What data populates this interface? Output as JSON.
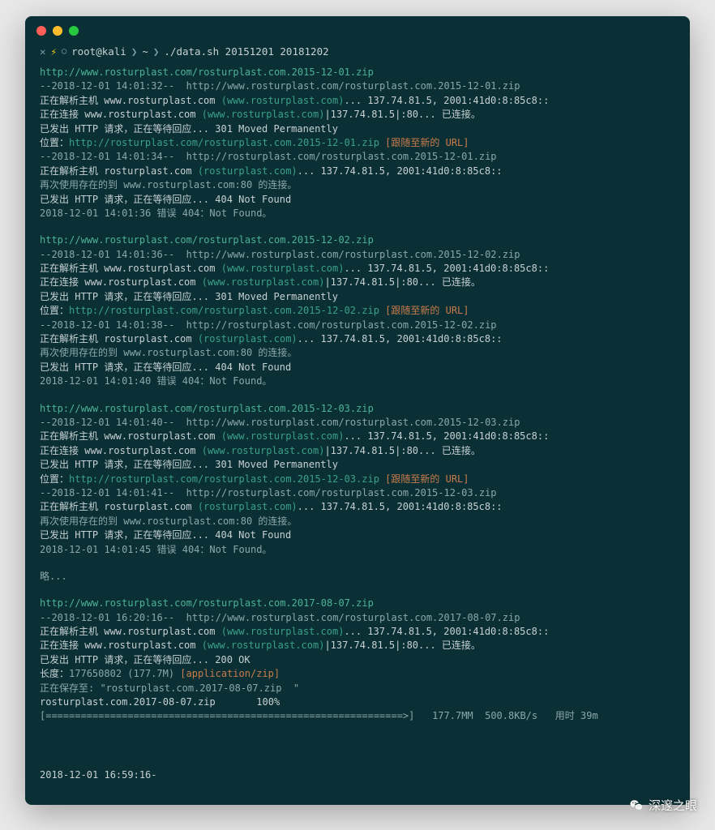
{
  "prompt": {
    "user": "root@kali",
    "tilde": "~",
    "command": "./data.sh 20151201 20181202"
  },
  "sections": [
    {
      "lines": [
        {
          "parts": [
            {
              "t": "http://www.rosturplast.com/rosturplast.com.2015-12-01.zip",
              "c": "url2"
            }
          ]
        },
        {
          "parts": [
            {
              "t": "--2018-12-01 14:01:32--  http://www.rosturplast.com/rosturplast.com.2015-12-01.zip",
              "c": "dim"
            }
          ]
        },
        {
          "parts": [
            {
              "t": "正在解析主机 www.rosturplast.com ",
              "c": "txt"
            },
            {
              "t": "(www.rosturplast.com)",
              "c": "green"
            },
            {
              "t": "... 137.74.81.5, 2001:41d0:8:85c8::",
              "c": "txt"
            }
          ]
        },
        {
          "parts": [
            {
              "t": "正在连接 www.rosturplast.com ",
              "c": "txt"
            },
            {
              "t": "(www.rosturplast.com)",
              "c": "green"
            },
            {
              "t": "|137.74.81.5|:80... 已连接。",
              "c": "txt"
            }
          ]
        },
        {
          "parts": [
            {
              "t": "已发出 HTTP 请求，正在等待回应... 301 Moved Permanently",
              "c": "txt"
            }
          ]
        },
        {
          "parts": [
            {
              "t": "位置：",
              "c": "txt"
            },
            {
              "t": "http://rosturplast.com/rosturplast.com.2015-12-01.zip",
              "c": "url"
            },
            {
              "t": " [跟随至新的 URL]",
              "c": "orange"
            }
          ]
        },
        {
          "parts": [
            {
              "t": "--2018-12-01 14:01:34--  http://rosturplast.com/rosturplast.com.2015-12-01.zip",
              "c": "dim"
            }
          ]
        },
        {
          "parts": [
            {
              "t": "正在解析主机 rosturplast.com ",
              "c": "txt"
            },
            {
              "t": "(rosturplast.com)",
              "c": "green"
            },
            {
              "t": "... 137.74.81.5, 2001:41d0:8:85c8::",
              "c": "txt"
            }
          ]
        },
        {
          "parts": [
            {
              "t": "再次使用存在的到 www.rosturplast.com:80 的连接。",
              "c": "dim"
            }
          ]
        },
        {
          "parts": [
            {
              "t": "已发出 HTTP 请求，正在等待回应... 404 Not Found",
              "c": "txt"
            }
          ]
        },
        {
          "parts": [
            {
              "t": "2018-12-01 14:01:36 错误 404：Not Found。",
              "c": "dim"
            }
          ]
        }
      ]
    },
    {
      "lines": [
        {
          "parts": [
            {
              "t": "http://www.rosturplast.com/rosturplast.com.2015-12-02.zip",
              "c": "url2"
            }
          ]
        },
        {
          "parts": [
            {
              "t": "--2018-12-01 14:01:36--  http://www.rosturplast.com/rosturplast.com.2015-12-02.zip",
              "c": "dim"
            }
          ]
        },
        {
          "parts": [
            {
              "t": "正在解析主机 www.rosturplast.com ",
              "c": "txt"
            },
            {
              "t": "(www.rosturplast.com)",
              "c": "green"
            },
            {
              "t": "... 137.74.81.5, 2001:41d0:8:85c8::",
              "c": "txt"
            }
          ]
        },
        {
          "parts": [
            {
              "t": "正在连接 www.rosturplast.com ",
              "c": "txt"
            },
            {
              "t": "(www.rosturplast.com)",
              "c": "green"
            },
            {
              "t": "|137.74.81.5|:80... 已连接。",
              "c": "txt"
            }
          ]
        },
        {
          "parts": [
            {
              "t": "已发出 HTTP 请求，正在等待回应... 301 Moved Permanently",
              "c": "txt"
            }
          ]
        },
        {
          "parts": [
            {
              "t": "位置：",
              "c": "txt"
            },
            {
              "t": "http://rosturplast.com/rosturplast.com.2015-12-02.zip",
              "c": "url"
            },
            {
              "t": " [跟随至新的 URL]",
              "c": "orange"
            }
          ]
        },
        {
          "parts": [
            {
              "t": "--2018-12-01 14:01:38--  http://rosturplast.com/rosturplast.com.2015-12-02.zip",
              "c": "dim"
            }
          ]
        },
        {
          "parts": [
            {
              "t": "正在解析主机 rosturplast.com ",
              "c": "txt"
            },
            {
              "t": "(rosturplast.com)",
              "c": "green"
            },
            {
              "t": "... 137.74.81.5, 2001:41d0:8:85c8::",
              "c": "txt"
            }
          ]
        },
        {
          "parts": [
            {
              "t": "再次使用存在的到 www.rosturplast.com:80 的连接。",
              "c": "dim"
            }
          ]
        },
        {
          "parts": [
            {
              "t": "已发出 HTTP 请求，正在等待回应... 404 Not Found",
              "c": "txt"
            }
          ]
        },
        {
          "parts": [
            {
              "t": "2018-12-01 14:01:40 错误 404：Not Found。",
              "c": "dim"
            }
          ]
        }
      ]
    },
    {
      "lines": [
        {
          "parts": [
            {
              "t": "http://www.rosturplast.com/rosturplast.com.2015-12-03.zip",
              "c": "url2"
            }
          ]
        },
        {
          "parts": [
            {
              "t": "--2018-12-01 14:01:40--  http://www.rosturplast.com/rosturplast.com.2015-12-03.zip",
              "c": "dim"
            }
          ]
        },
        {
          "parts": [
            {
              "t": "正在解析主机 www.rosturplast.com ",
              "c": "txt"
            },
            {
              "t": "(www.rosturplast.com)",
              "c": "green"
            },
            {
              "t": "... 137.74.81.5, 2001:41d0:8:85c8::",
              "c": "txt"
            }
          ]
        },
        {
          "parts": [
            {
              "t": "正在连接 www.rosturplast.com ",
              "c": "txt"
            },
            {
              "t": "(www.rosturplast.com)",
              "c": "green"
            },
            {
              "t": "|137.74.81.5|:80... 已连接。",
              "c": "txt"
            }
          ]
        },
        {
          "parts": [
            {
              "t": "已发出 HTTP 请求，正在等待回应... 301 Moved Permanently",
              "c": "txt"
            }
          ]
        },
        {
          "parts": [
            {
              "t": "位置：",
              "c": "txt"
            },
            {
              "t": "http://rosturplast.com/rosturplast.com.2015-12-03.zip",
              "c": "url"
            },
            {
              "t": " [跟随至新的 URL]",
              "c": "orange"
            }
          ]
        },
        {
          "parts": [
            {
              "t": "--2018-12-01 14:01:41--  http://rosturplast.com/rosturplast.com.2015-12-03.zip",
              "c": "dim"
            }
          ]
        },
        {
          "parts": [
            {
              "t": "正在解析主机 rosturplast.com ",
              "c": "txt"
            },
            {
              "t": "(rosturplast.com)",
              "c": "green"
            },
            {
              "t": "... 137.74.81.5, 2001:41d0:8:85c8::",
              "c": "txt"
            }
          ]
        },
        {
          "parts": [
            {
              "t": "再次使用存在的到 www.rosturplast.com:80 的连接。",
              "c": "dim"
            }
          ]
        },
        {
          "parts": [
            {
              "t": "已发出 HTTP 请求，正在等待回应... 404 Not Found",
              "c": "txt"
            }
          ]
        },
        {
          "parts": [
            {
              "t": "2018-12-01 14:01:45 错误 404：Not Found。",
              "c": "dim"
            }
          ]
        }
      ]
    },
    {
      "lines": [
        {
          "parts": [
            {
              "t": "略...",
              "c": "dim"
            }
          ]
        }
      ]
    },
    {
      "lines": [
        {
          "parts": [
            {
              "t": "http://www.rosturplast.com/rosturplast.com.2017-08-07.zip",
              "c": "url2"
            }
          ]
        },
        {
          "parts": [
            {
              "t": "--2018-12-01 16:20:16--  http://www.rosturplast.com/rosturplast.com.2017-08-07.zip",
              "c": "dim"
            }
          ]
        },
        {
          "parts": [
            {
              "t": "正在解析主机 www.rosturplast.com ",
              "c": "txt"
            },
            {
              "t": "(www.rosturplast.com)",
              "c": "green"
            },
            {
              "t": "... 137.74.81.5, 2001:41d0:8:85c8::",
              "c": "txt"
            }
          ]
        },
        {
          "parts": [
            {
              "t": "正在连接 www.rosturplast.com ",
              "c": "txt"
            },
            {
              "t": "(www.rosturplast.com)",
              "c": "green"
            },
            {
              "t": "|137.74.81.5|:80... 已连接。",
              "c": "txt"
            }
          ]
        },
        {
          "parts": [
            {
              "t": "已发出 HTTP 请求，正在等待回应... 200 OK",
              "c": "txt"
            }
          ]
        },
        {
          "parts": [
            {
              "t": "长度：",
              "c": "txt"
            },
            {
              "t": "177650802 (177.7M)",
              "c": "dim"
            },
            {
              "t": " [application/zip]",
              "c": "orange"
            }
          ]
        },
        {
          "parts": [
            {
              "t": "正在保存至: \"rosturplast.com.2017-08-07.zip  \"",
              "c": "dim"
            }
          ]
        },
        {
          "parts": [
            {
              "t": "",
              "c": "txt"
            }
          ]
        },
        {
          "parts": [
            {
              "t": "rosturplast.com.2017-08-07.zip       100%",
              "c": "txt"
            }
          ]
        },
        {
          "parts": [
            {
              "t": "[",
              "c": "dim"
            },
            {
              "t": "=============================================================>",
              "c": "dim"
            },
            {
              "t": "]   177.7MM  500.8KB/s   用时 39m",
              "c": "dim"
            }
          ]
        }
      ]
    }
  ],
  "footer_timestamp": "2018-12-01 16:59:16-",
  "watermark": "深邃之眼"
}
